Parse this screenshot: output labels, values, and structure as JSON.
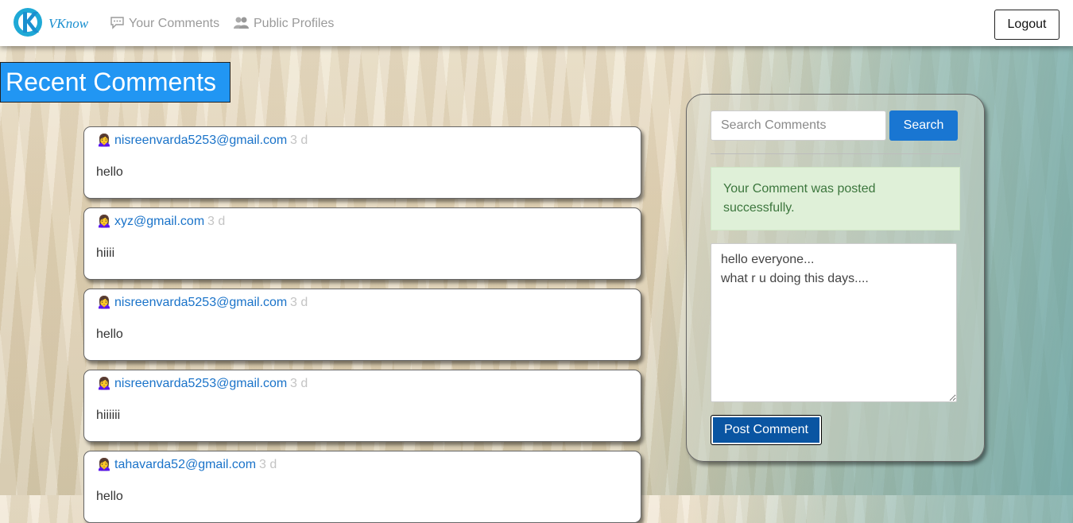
{
  "nav": {
    "brand": "VKnow",
    "links": [
      {
        "label": "Your Comments",
        "icon": "chat-bubble-icon"
      },
      {
        "label": "Public Profiles",
        "icon": "users-icon"
      }
    ],
    "logout_label": "Logout"
  },
  "heading": "Recent Comments",
  "comments": [
    {
      "author": "nisreenvarda5253@gmail.com",
      "time": "3 d",
      "text": "hello"
    },
    {
      "author": "xyz@gmail.com",
      "time": "3 d",
      "text": "hiiii"
    },
    {
      "author": "nisreenvarda5253@gmail.com",
      "time": "3 d",
      "text": "hello"
    },
    {
      "author": "nisreenvarda5253@gmail.com",
      "time": "3 d",
      "text": "hiiiiii"
    },
    {
      "author": "tahavarda52@gmail.com",
      "time": "3 d",
      "text": "hello"
    }
  ],
  "sidebar": {
    "search": {
      "placeholder": "Search Comments",
      "button_label": "Search"
    },
    "alert": "Your Comment was posted successfully.",
    "comment_input": "hello everyone...\nwhat r u doing this days....",
    "post_label": "Post Comment"
  },
  "colors": {
    "accent": "#2196f3",
    "primary_button": "#1976d2",
    "post_button": "#0a55a2",
    "author_link": "#1a73c9",
    "alert_bg": "#dff0d8",
    "alert_text": "#3c763d"
  }
}
